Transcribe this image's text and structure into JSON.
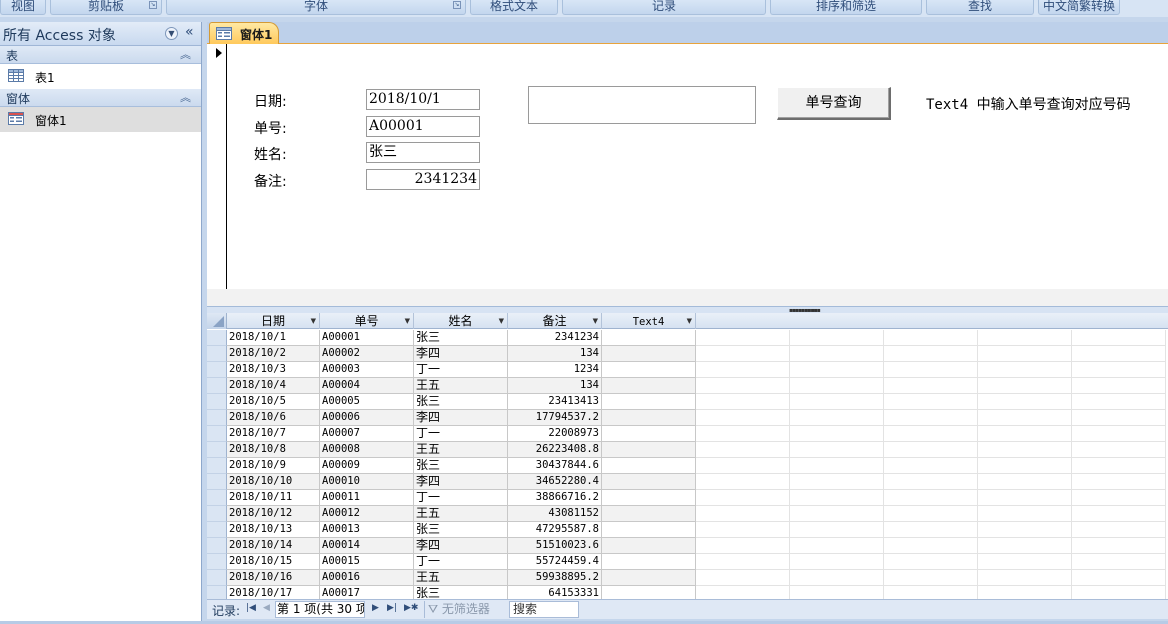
{
  "ribbon": {
    "groups": [
      {
        "label": "视图",
        "launcher": false
      },
      {
        "label": "剪贴板",
        "launcher": true
      },
      {
        "label": "字体",
        "launcher": true
      },
      {
        "label": "格式文本",
        "launcher": false
      },
      {
        "label": "记录",
        "launcher": false
      },
      {
        "label": "排序和筛选",
        "launcher": false
      },
      {
        "label": "查找",
        "launcher": false
      },
      {
        "label": "中文简繁转换",
        "launcher": false
      }
    ]
  },
  "nav": {
    "title": "所有 Access 对象",
    "groups": [
      {
        "label": "表",
        "items": [
          "表1"
        ]
      },
      {
        "label": "窗体",
        "items": [
          "窗体1"
        ]
      }
    ]
  },
  "document": {
    "tab_label": "窗体1"
  },
  "form": {
    "date_label": "日期:",
    "date_value": "2018/10/1",
    "number_label": "单号:",
    "number_value": "A00001",
    "name_label": "姓名:",
    "name_value": "张三",
    "note_label": "备注:",
    "note_value": "2341234",
    "text4_value": "",
    "query_button": "单号查询",
    "hint": "Text4 中输入单号查询对应号码"
  },
  "datasheet": {
    "columns": [
      "日期",
      "单号",
      "姓名",
      "备注",
      "Text4"
    ],
    "rows": [
      [
        "2018/10/1",
        "A00001",
        "张三",
        "2341234",
        ""
      ],
      [
        "2018/10/2",
        "A00002",
        "李四",
        "134",
        ""
      ],
      [
        "2018/10/3",
        "A00003",
        "丁一",
        "1234",
        ""
      ],
      [
        "2018/10/4",
        "A00004",
        "王五",
        "134",
        ""
      ],
      [
        "2018/10/5",
        "A00005",
        "张三",
        "23413413",
        ""
      ],
      [
        "2018/10/6",
        "A00006",
        "李四",
        "17794537.2",
        ""
      ],
      [
        "2018/10/7",
        "A00007",
        "丁一",
        "22008973",
        ""
      ],
      [
        "2018/10/8",
        "A00008",
        "王五",
        "26223408.8",
        ""
      ],
      [
        "2018/10/9",
        "A00009",
        "张三",
        "30437844.6",
        ""
      ],
      [
        "2018/10/10",
        "A00010",
        "李四",
        "34652280.4",
        ""
      ],
      [
        "2018/10/11",
        "A00011",
        "丁一",
        "38866716.2",
        ""
      ],
      [
        "2018/10/12",
        "A00012",
        "王五",
        "43081152",
        ""
      ],
      [
        "2018/10/13",
        "A00013",
        "张三",
        "47295587.8",
        ""
      ],
      [
        "2018/10/14",
        "A00014",
        "李四",
        "51510023.6",
        ""
      ],
      [
        "2018/10/15",
        "A00015",
        "丁一",
        "55724459.4",
        ""
      ],
      [
        "2018/10/16",
        "A00016",
        "王五",
        "59938895.2",
        ""
      ],
      [
        "2018/10/17",
        "A00017",
        "张三",
        "64153331",
        ""
      ]
    ]
  },
  "navbar": {
    "record_label": "记录:",
    "record_counter": "第 1 项(共 30 项",
    "filter_status": "无筛选器",
    "search_label": "搜索"
  },
  "icons": {
    "table": "table-icon",
    "form": "form-icon",
    "filter": "funnel-icon"
  },
  "colors": {
    "active_tab": "#ffc95c",
    "tab_border": "#e8a33c",
    "ribbon_text": "#2f4d7a",
    "nav_header_text": "#1e395b"
  }
}
